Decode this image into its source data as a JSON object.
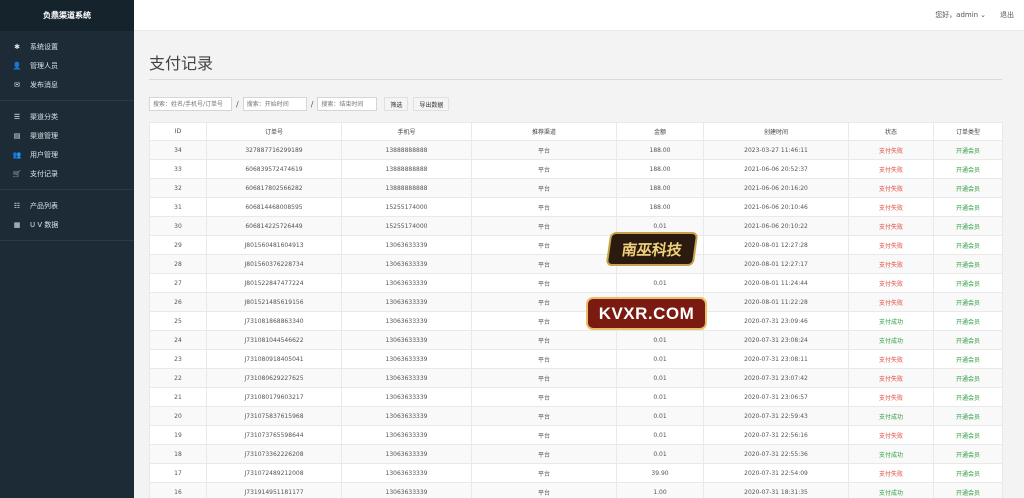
{
  "sidebar": {
    "brand": "负鼎渠道系统",
    "groups": [
      [
        {
          "icon": "gear-icon",
          "glyph": "✱",
          "label": "系统设置"
        },
        {
          "icon": "user-icon",
          "glyph": "👤",
          "label": "管理人员"
        },
        {
          "icon": "message-icon",
          "glyph": "✉",
          "label": "发布消息"
        }
      ],
      [
        {
          "icon": "list-icon",
          "glyph": "☰",
          "label": "渠道分类"
        },
        {
          "icon": "channel-icon",
          "glyph": "▤",
          "label": "渠道管理"
        },
        {
          "icon": "users-icon",
          "glyph": "👥",
          "label": "用户管理"
        },
        {
          "icon": "cart-icon",
          "glyph": "🛒",
          "label": "支付记录"
        }
      ],
      [
        {
          "icon": "grid-list-icon",
          "glyph": "☷",
          "label": "产品列表"
        },
        {
          "icon": "chart-icon",
          "glyph": "▦",
          "label": "U V 数据"
        }
      ]
    ]
  },
  "topbar": {
    "user_label": "您好，admin",
    "logout_label": "退出"
  },
  "page": {
    "title": "支付记录"
  },
  "filters": {
    "keyword_placeholder": "搜索：姓名/手机号/订单号",
    "start_placeholder": "搜索：开始时间",
    "end_placeholder": "搜索：结束时间",
    "separator": "/",
    "search_label": "筛选",
    "export_label": "导出数据"
  },
  "table": {
    "columns": [
      "ID",
      "订单号",
      "手机号",
      "推荐渠道",
      "金额",
      "创建时间",
      "状态",
      "订单类型"
    ],
    "rows": [
      [
        "34",
        "327887716299189",
        "13888888888",
        "平台",
        "188.00",
        "2023-03-27 11:46:11",
        "支付失败",
        "开通会员"
      ],
      [
        "33",
        "606839572474619",
        "13888888888",
        "平台",
        "188.00",
        "2021-06-06 20:52:37",
        "支付失败",
        "开通会员"
      ],
      [
        "32",
        "606817802566282",
        "13888888888",
        "平台",
        "188.00",
        "2021-06-06 20:16:20",
        "支付失败",
        "开通会员"
      ],
      [
        "31",
        "606814468008595",
        "15255174000",
        "平台",
        "188.00",
        "2021-06-06 20:10:46",
        "支付失败",
        "开通会员"
      ],
      [
        "30",
        "606814225726449",
        "15255174000",
        "平台",
        "0.01",
        "2021-06-06 20:10:22",
        "支付失败",
        "开通会员"
      ],
      [
        "29",
        "J801560481604913",
        "13063633339",
        "平台",
        "0.01",
        "2020-08-01 12:27:28",
        "支付失败",
        "开通会员"
      ],
      [
        "28",
        "J801560376228734",
        "13063633339",
        "平台",
        "0.01",
        "2020-08-01 12:27:17",
        "支付失败",
        "开通会员"
      ],
      [
        "27",
        "J801522847477224",
        "13063633339",
        "平台",
        "0.01",
        "2020-08-01 11:24:44",
        "支付失败",
        "开通会员"
      ],
      [
        "26",
        "J801521485619156",
        "13063633339",
        "平台",
        "0.01",
        "2020-08-01 11:22:28",
        "支付失败",
        "开通会员"
      ],
      [
        "25",
        "J731081868863340",
        "13063633339",
        "平台",
        "0.01",
        "2020-07-31 23:09:46",
        "支付成功",
        "开通会员"
      ],
      [
        "24",
        "J731081044546622",
        "13063633339",
        "平台",
        "0.01",
        "2020-07-31 23:08:24",
        "支付成功",
        "开通会员"
      ],
      [
        "23",
        "J731080918405041",
        "13063633339",
        "平台",
        "0.01",
        "2020-07-31 23:08:11",
        "支付失败",
        "开通会员"
      ],
      [
        "22",
        "J731080629227625",
        "13063633339",
        "平台",
        "0.01",
        "2020-07-31 23:07:42",
        "支付失败",
        "开通会员"
      ],
      [
        "21",
        "J731080179603217",
        "13063633339",
        "平台",
        "0.01",
        "2020-07-31 23:06:57",
        "支付失败",
        "开通会员"
      ],
      [
        "20",
        "J731075837615968",
        "13063633339",
        "平台",
        "0.01",
        "2020-07-31 22:59:43",
        "支付成功",
        "开通会员"
      ],
      [
        "19",
        "J731073765598644",
        "13063633339",
        "平台",
        "0.01",
        "2020-07-31 22:56:16",
        "支付失败",
        "开通会员"
      ],
      [
        "18",
        "J731073362226208",
        "13063633339",
        "平台",
        "0.01",
        "2020-07-31 22:55:36",
        "支付成功",
        "开通会员"
      ],
      [
        "17",
        "J731072489212008",
        "13063633339",
        "平台",
        "39.90",
        "2020-07-31 22:54:09",
        "支付失败",
        "开通会员"
      ],
      [
        "16",
        "J731914951181177",
        "13063633339",
        "平台",
        "1.00",
        "2020-07-31 18:31:35",
        "支付成功",
        "开通会员"
      ]
    ]
  },
  "watermarks": {
    "logo1": "南巫科技",
    "logo2": "KVXR.COM"
  },
  "colors": {
    "sidebar_bg": "#1c2b36",
    "status_fail": "#e04a3c",
    "status_ok": "#2f9e44"
  }
}
